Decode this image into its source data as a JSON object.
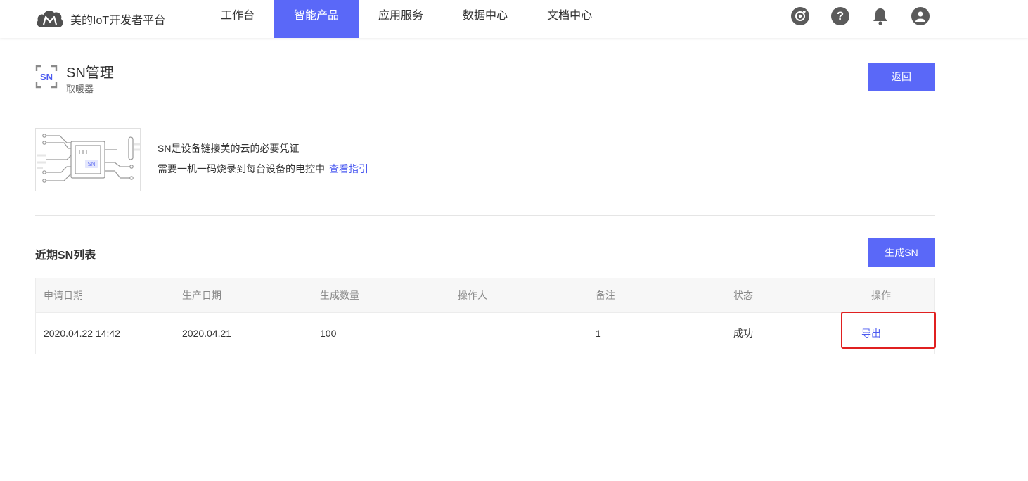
{
  "brand": {
    "name": "美的IoT开发者平台",
    "logo_icon": "cloud-m-logo-icon"
  },
  "nav": {
    "items": [
      "工作台",
      "智能产品",
      "应用服务",
      "数据中心",
      "文档中心"
    ],
    "active": "智能产品"
  },
  "top_icons": [
    "target-icon",
    "help-icon",
    "bell-icon",
    "user-avatar-icon"
  ],
  "top_icon_glyphs": {
    "help": "?"
  },
  "header": {
    "title": "SN管理",
    "subtitle": "取暖器",
    "back_label": "返回",
    "icon_text": "SN"
  },
  "info": {
    "line1": "SN是设备链接美的云的必要凭证",
    "line2": "需要一机一码烧录到每台设备的电控中",
    "link": "查看指引",
    "chip_label": "SN"
  },
  "list": {
    "title": "近期SN列表",
    "generate_label": "生成SN",
    "columns": [
      "申请日期",
      "生产日期",
      "生成数量",
      "操作人",
      "备注",
      "状态",
      "操作"
    ],
    "rows": [
      {
        "apply_date": "2020.04.22 14:42",
        "production_date": "2020.04.21",
        "quantity": "100",
        "operator": "",
        "remark": "1",
        "status": "成功",
        "action": "导出"
      }
    ]
  },
  "colors": {
    "accent": "#5a68f8",
    "link": "#4b5af0",
    "highlight": "#e02020"
  }
}
